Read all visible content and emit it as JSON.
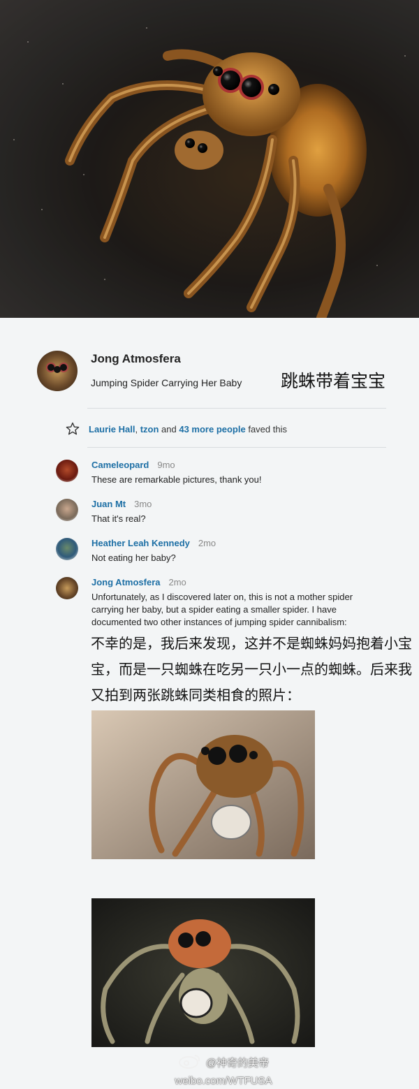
{
  "hero": {
    "alt": "jumping spider carrying smaller spider"
  },
  "post": {
    "author": "Jong Atmosfera",
    "title": "Jumping Spider Carrying Her Baby",
    "title_cn": "跳蛛带着宝宝"
  },
  "faves": {
    "user1": "Laurie Hall",
    "sep": ", ",
    "user2": "tzon",
    "and": " and ",
    "more": "43 more people",
    "suffix": " faved this"
  },
  "comments": [
    {
      "name": "Cameleopard",
      "time": "9mo",
      "text": "These are remarkable pictures, thank you!"
    },
    {
      "name": "Juan Mt",
      "time": "3mo",
      "text": "That it's real?"
    },
    {
      "name": "Heather Leah Kennedy",
      "time": "2mo",
      "text": "Not eating her baby?"
    },
    {
      "name": "Jong Atmosfera",
      "time": "2mo",
      "text": "Unfortunately, as I discovered later on, this is not a mother spider carrying her baby, but a spider eating a smaller spider. I have documented two other instances of jumping spider cannibalism:"
    }
  ],
  "translation_cn": "不幸的是，我后来发现，这并不是蜘蛛妈妈抱着小宝宝，而是一只蜘蛛在吃另一只小一点的蜘蛛。后来我又拍到两张跳蛛同类相食的照片：",
  "watermark": {
    "handle": "@神奇的美帝",
    "url": "weibo.com/WTFUSA"
  },
  "colors": {
    "link": "#1d6fa5",
    "background": "#f3f5f6"
  }
}
